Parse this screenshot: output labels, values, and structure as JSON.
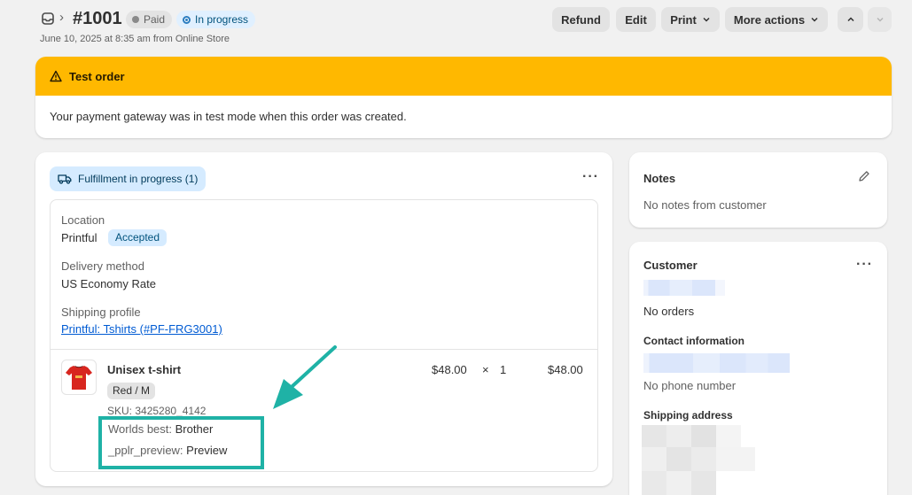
{
  "header": {
    "order_number": "#1001",
    "badges": {
      "paid": "Paid",
      "in_progress": "In progress"
    },
    "subline": "June 10, 2025 at 8:35 am from Online Store",
    "actions": {
      "refund": "Refund",
      "edit": "Edit",
      "print": "Print",
      "more": "More actions"
    }
  },
  "banner": {
    "title": "Test order",
    "body": "Your payment gateway was in test mode when this order was created.",
    "color": "#ffb800"
  },
  "fulfillment": {
    "status_label": "Fulfillment in progress (1)",
    "location_label": "Location",
    "location_value": "Printful",
    "location_status": "Accepted",
    "delivery_label": "Delivery method",
    "delivery_value": "US Economy Rate",
    "shipping_profile_label": "Shipping profile",
    "shipping_profile_link": "Printful: Tshirts (#PF-FRG3001)",
    "item": {
      "name": "Unisex t-shirt",
      "variant": "Red / M",
      "sku": "SKU: 3425280_4142",
      "price": "$48.00",
      "times": "×",
      "qty": "1",
      "total": "$48.00",
      "properties": [
        {
          "key": "Worlds best:",
          "value": "Brother"
        },
        {
          "key": "_pplr_preview:",
          "value": "Preview"
        }
      ]
    }
  },
  "notes": {
    "title": "Notes",
    "body": "No notes from customer"
  },
  "customer": {
    "title": "Customer",
    "orders": "No orders",
    "contact_title": "Contact information",
    "phone": "No phone number",
    "shipping_title": "Shipping address"
  },
  "annotation_color": "#1fb2a6"
}
